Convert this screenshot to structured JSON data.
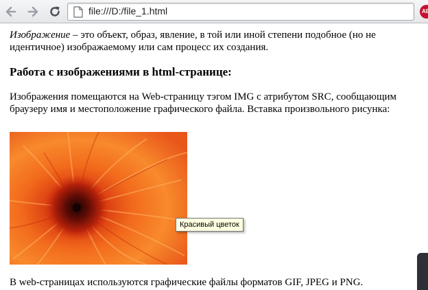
{
  "browser": {
    "url": "file:///D:/file_1.html",
    "extension_label": "ABP"
  },
  "page": {
    "p1_term": "Изображение",
    "p1_rest": " – это объект, образ, явление, в той или иной степени подобное (но не идентичное) изображаемому или сам процесс их создания.",
    "heading": "Работа с изображениями в html-странице:",
    "p2": "Изображения помещаются на Web-страницу тэгом IMG с атрибутом SRC, сообщающим браузеру имя и местоположение графического файла. Вставка произвольного рисунка:",
    "image_tooltip": "Красивый цветок",
    "p3": "В web-страницах используются графические файлы форматов GIF, JPEG и PNG."
  }
}
